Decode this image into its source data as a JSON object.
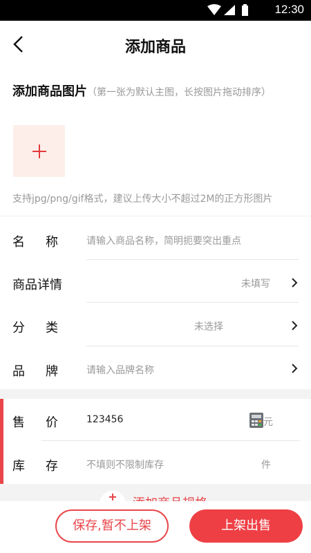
{
  "status_bar": {
    "time": "12:30",
    "icons": [
      "wifi-icon",
      "signal-icon",
      "battery-icon"
    ]
  },
  "header": {
    "title": "添加商品",
    "back_icon": "back-arrow-icon"
  },
  "images_section": {
    "title": "添加商品图片",
    "hint": "（第一张为默认主图，长按图片拖动排序）",
    "support_note": "支持jpg/png/gif格式，建议上传大小不超过2M的正方形图片"
  },
  "form": {
    "name": {
      "label": "名称",
      "placeholder": "请输入商品名称，简明扼要突出重点"
    },
    "detail": {
      "label": "商品详情",
      "value": "未填写"
    },
    "category": {
      "label": "分类",
      "value": "未选择"
    },
    "brand": {
      "label": "品牌",
      "placeholder": "请输入品牌名称"
    },
    "price": {
      "label": "售价",
      "value": "123456",
      "unit": "元"
    },
    "stock": {
      "label": "库存",
      "placeholder": "不填则不限制库存",
      "unit": "件"
    }
  },
  "add_spec": {
    "label": "添加商品规格"
  },
  "actions": {
    "save_label": "保存,暂不上架",
    "publish_label": "上架出售"
  },
  "colors": {
    "accent": "#e8454a",
    "placeholder": "#999999",
    "image_tile_bg": "#fdeeea"
  }
}
